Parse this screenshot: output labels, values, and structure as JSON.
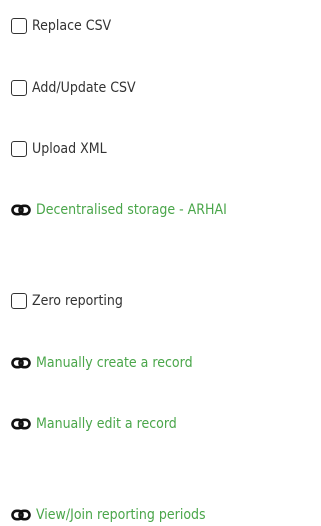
{
  "options": [
    {
      "label": "Replace CSV",
      "kind": "checkbox",
      "checked": false,
      "icon": "checkbox-icon"
    },
    {
      "label": "Add/Update CSV",
      "kind": "checkbox",
      "checked": false,
      "icon": "checkbox-icon"
    },
    {
      "label": "Upload XML",
      "kind": "checkbox",
      "checked": false,
      "icon": "checkbox-icon"
    },
    {
      "label": "Decentralised storage - ARHAI",
      "kind": "link",
      "icon": "link-icon"
    },
    {
      "label": "Zero reporting",
      "kind": "checkbox",
      "checked": false,
      "icon": "checkbox-icon"
    },
    {
      "label": "Manually create a record",
      "kind": "link",
      "icon": "link-icon"
    },
    {
      "label": "Manually edit a record",
      "kind": "link",
      "icon": "link-icon"
    },
    {
      "label": "View/Join reporting periods",
      "kind": "link",
      "icon": "link-icon"
    }
  ],
  "colors": {
    "text": "#333333",
    "link": "#4aa64a",
    "icon": "#111111"
  }
}
